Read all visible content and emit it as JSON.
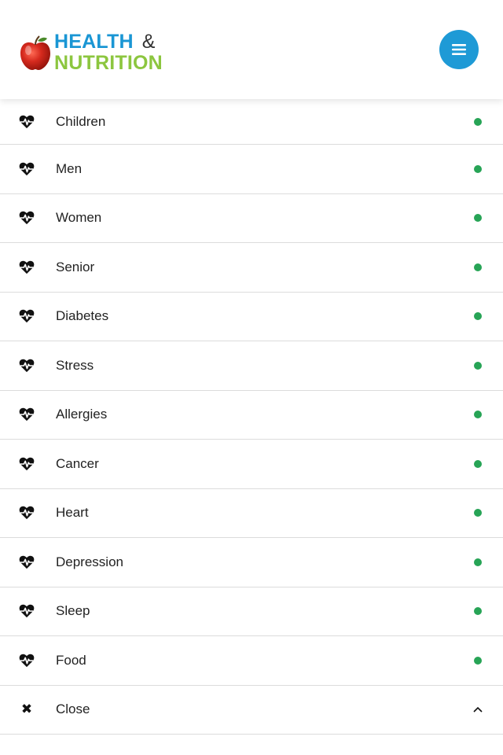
{
  "brand": {
    "line1": "HEALTH",
    "ampersand": "&",
    "line2": "NUTRITION",
    "colors": {
      "health": "#1a96d4",
      "nutrition": "#8cc63f",
      "ampersand": "#333333",
      "apple": "#d62a1e"
    }
  },
  "header": {
    "menu_button_icon": "hamburger-icon",
    "menu_button_color": "#1e9ad6"
  },
  "menu": {
    "item_icon": "heartbeat-icon",
    "dot_color": "#27a456",
    "items": [
      {
        "label": "Children"
      },
      {
        "label": "Men"
      },
      {
        "label": "Women"
      },
      {
        "label": "Senior"
      },
      {
        "label": "Diabetes"
      },
      {
        "label": "Stress"
      },
      {
        "label": "Allergies"
      },
      {
        "label": "Cancer"
      },
      {
        "label": "Heart"
      },
      {
        "label": "Depression"
      },
      {
        "label": "Sleep"
      },
      {
        "label": "Food"
      }
    ],
    "close": {
      "label": "Close",
      "icon": "close-icon",
      "toggle_icon": "chevron-up-icon"
    }
  }
}
